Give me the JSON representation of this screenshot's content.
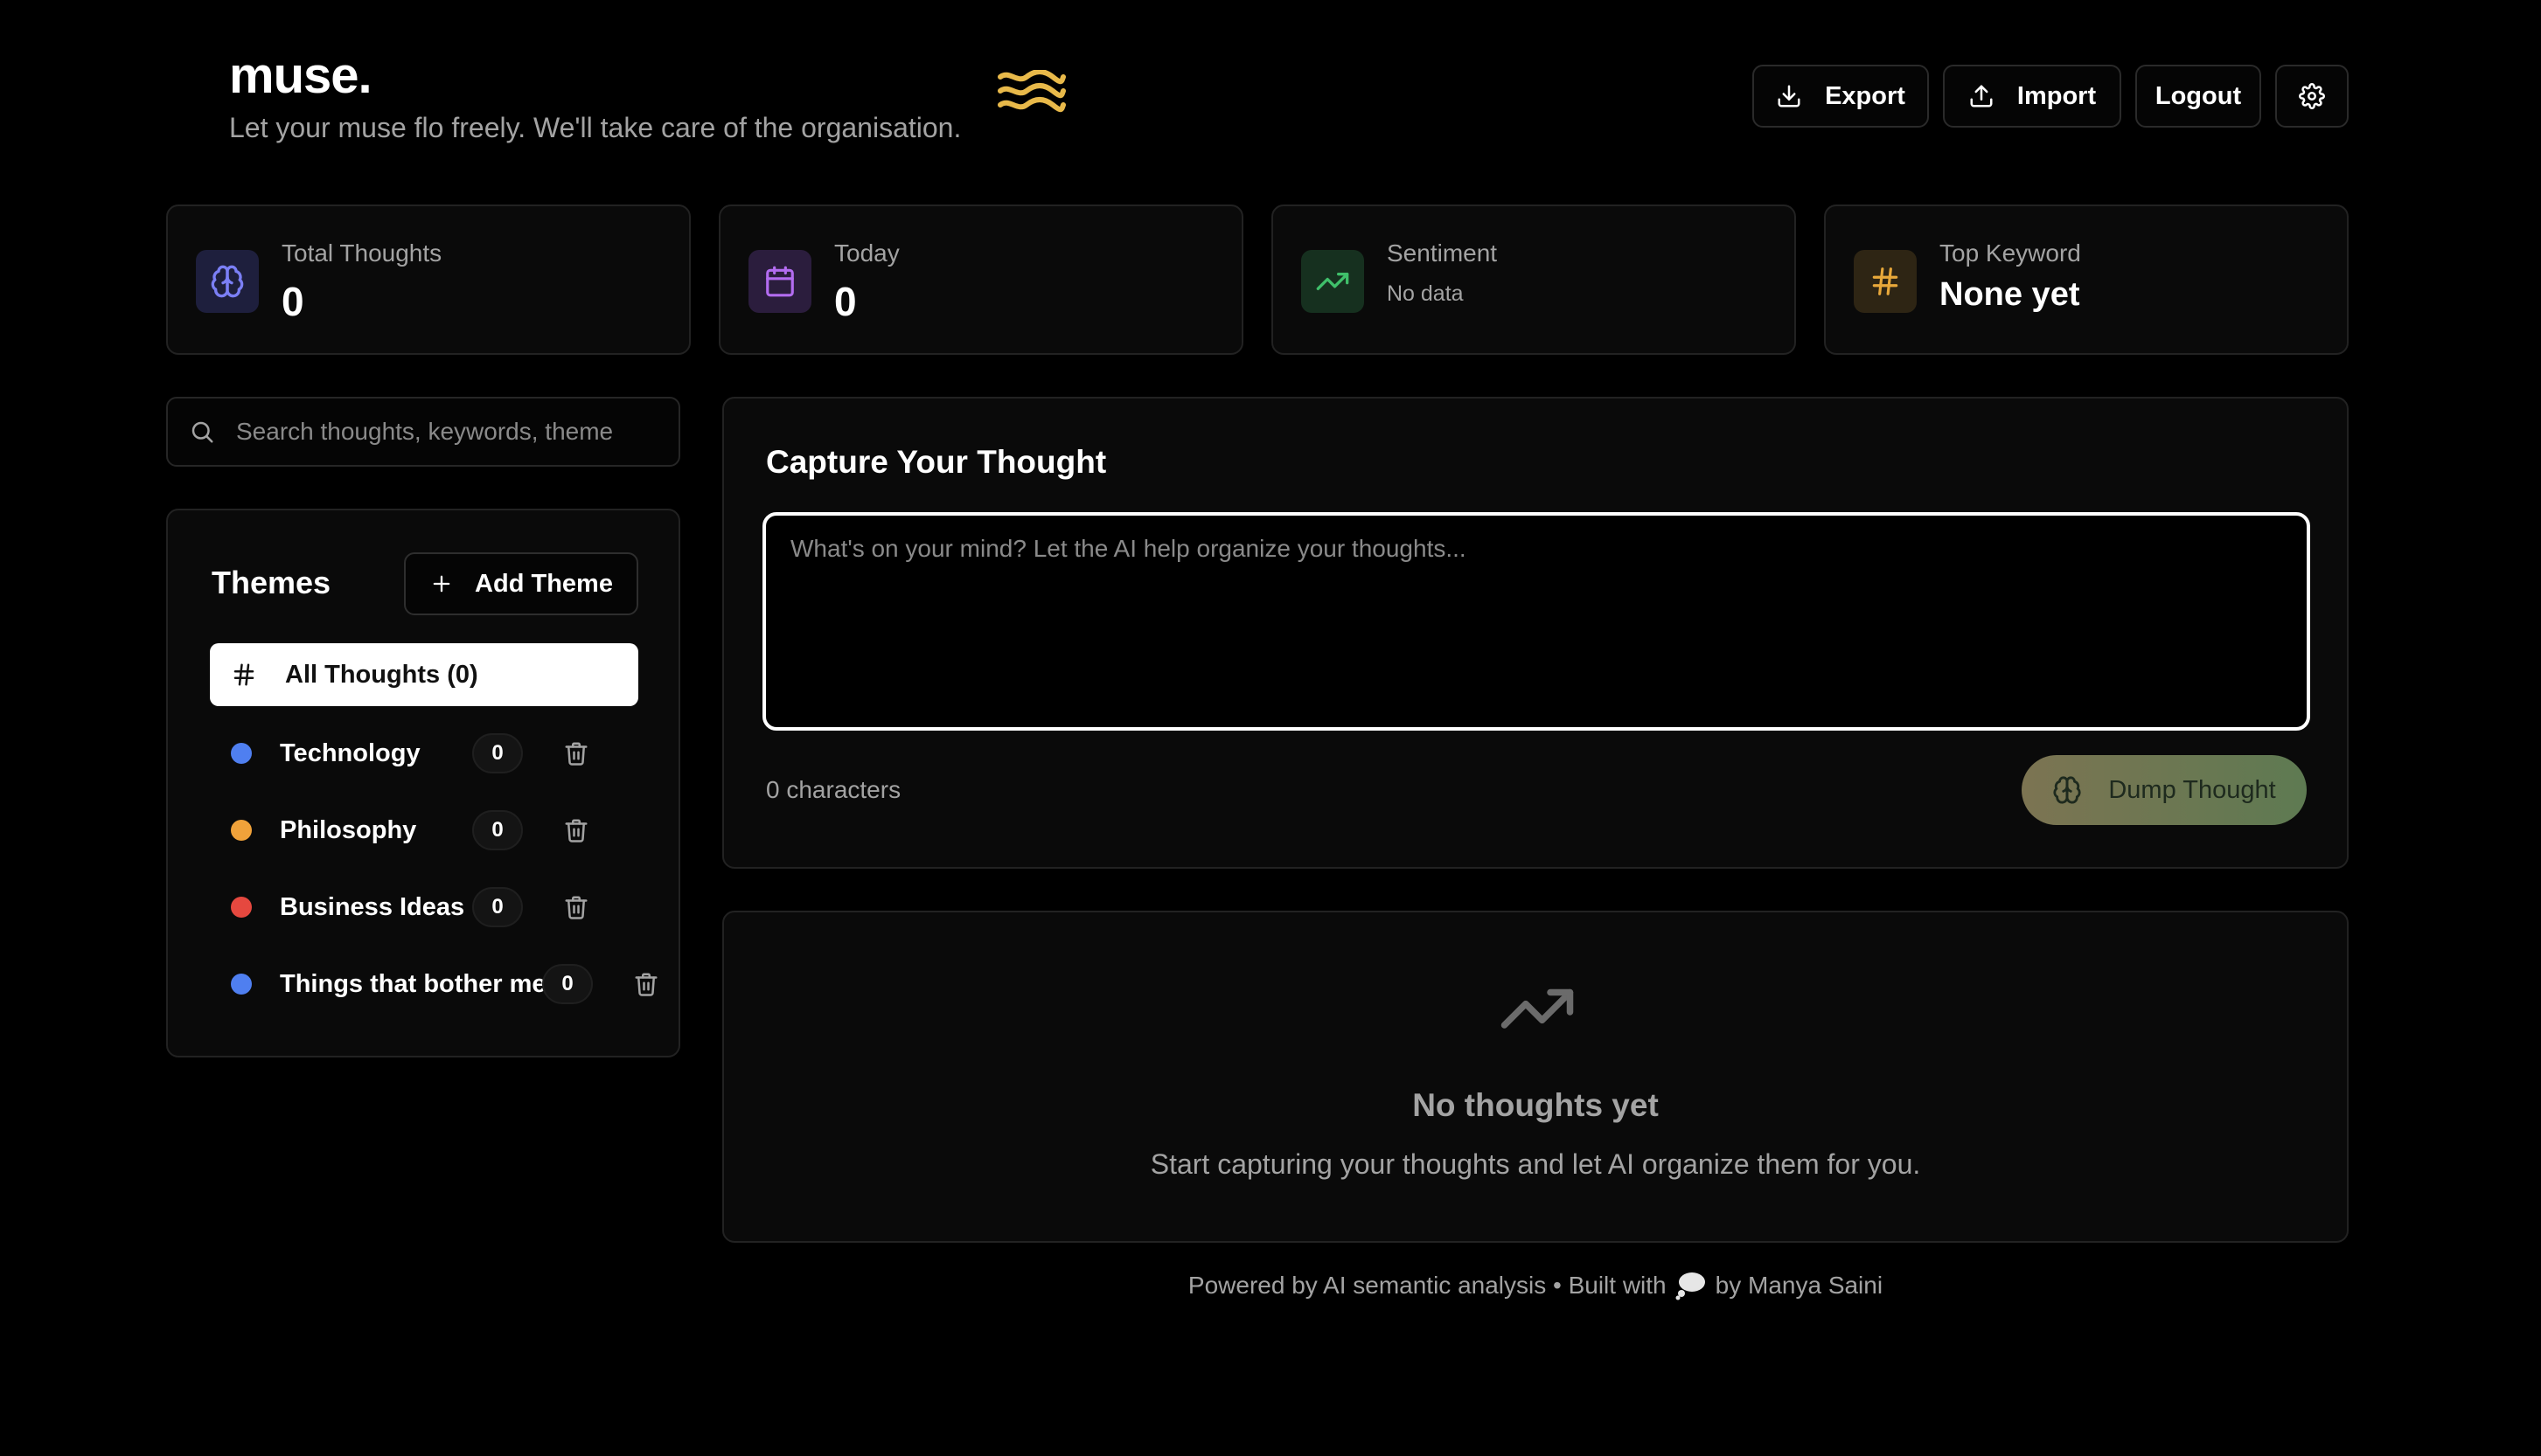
{
  "header": {
    "title": "muse.",
    "tagline": "Let your muse flo freely. We'll take care of the organisation.",
    "logo_icon": "waves-icon",
    "accent_color": "#e8b94a",
    "buttons": {
      "export": "Export",
      "import": "Import",
      "logout": "Logout",
      "settings_icon": "gear-icon"
    }
  },
  "stats": {
    "total": {
      "label": "Total Thoughts",
      "value": "0",
      "icon": "brain-icon"
    },
    "today": {
      "label": "Today",
      "value": "0",
      "icon": "calendar-icon"
    },
    "sentiment": {
      "label": "Sentiment",
      "value": "No data",
      "icon": "trending-up-icon"
    },
    "keyword": {
      "label": "Top Keyword",
      "value": "None yet",
      "icon": "hash-icon"
    }
  },
  "search": {
    "placeholder": "Search thoughts, keywords, themes..."
  },
  "themes": {
    "title": "Themes",
    "add_label": "Add Theme",
    "all_label": "All Thoughts (0)",
    "items": [
      {
        "label": "Technology",
        "count": "0",
        "color": "#4f7ff0"
      },
      {
        "label": "Philosophy",
        "count": "0",
        "color": "#f0a23a"
      },
      {
        "label": "Business Ideas",
        "count": "0",
        "color": "#e5483f"
      },
      {
        "label": "Things that bother me",
        "count": "0",
        "color": "#4f7ff0"
      }
    ]
  },
  "capture": {
    "title": "Capture Your Thought",
    "placeholder": "What's on your mind? Let the AI help organize your thoughts...",
    "char_count": "0 characters",
    "submit_label": "Dump Thought"
  },
  "empty_state": {
    "title": "No thoughts yet",
    "subtitle": "Start capturing your thoughts and let AI organize them for you."
  },
  "footer": {
    "text_before": "Powered by AI semantic analysis • Built with",
    "icon": "thought-bubble-icon",
    "text_after": "by Manya Saini"
  }
}
